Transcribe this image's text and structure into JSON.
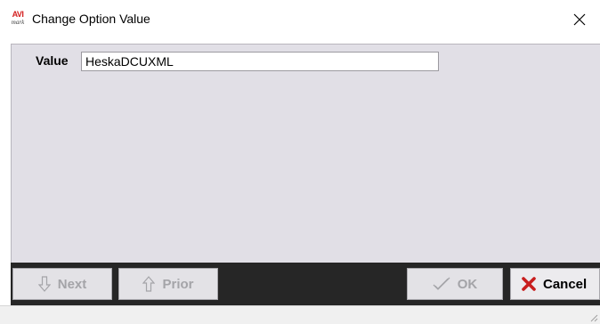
{
  "window": {
    "title": "Change Option Value",
    "icon_name": "avi-app-icon",
    "icon_text_top": "AVI",
    "icon_text_bottom": "mark"
  },
  "form": {
    "value_label": "Value",
    "value": "HeskaDCUXML"
  },
  "buttons": {
    "next_label": "Next",
    "prior_label": "Prior",
    "ok_label": "OK",
    "cancel_label": "Cancel",
    "next_enabled": false,
    "prior_enabled": false,
    "ok_enabled": false,
    "cancel_enabled": true
  },
  "icons": {
    "close": "close-icon",
    "next": "arrow-down-icon",
    "prior": "arrow-up-icon",
    "ok": "checkmark-icon",
    "cancel": "x-icon",
    "grip": "resize-grip-icon"
  },
  "colors": {
    "client_bg": "#e1dfe6",
    "button_bar_bg": "#262626",
    "disabled_text": "#a4a4a8",
    "cancel_x": "#c81e1e"
  }
}
